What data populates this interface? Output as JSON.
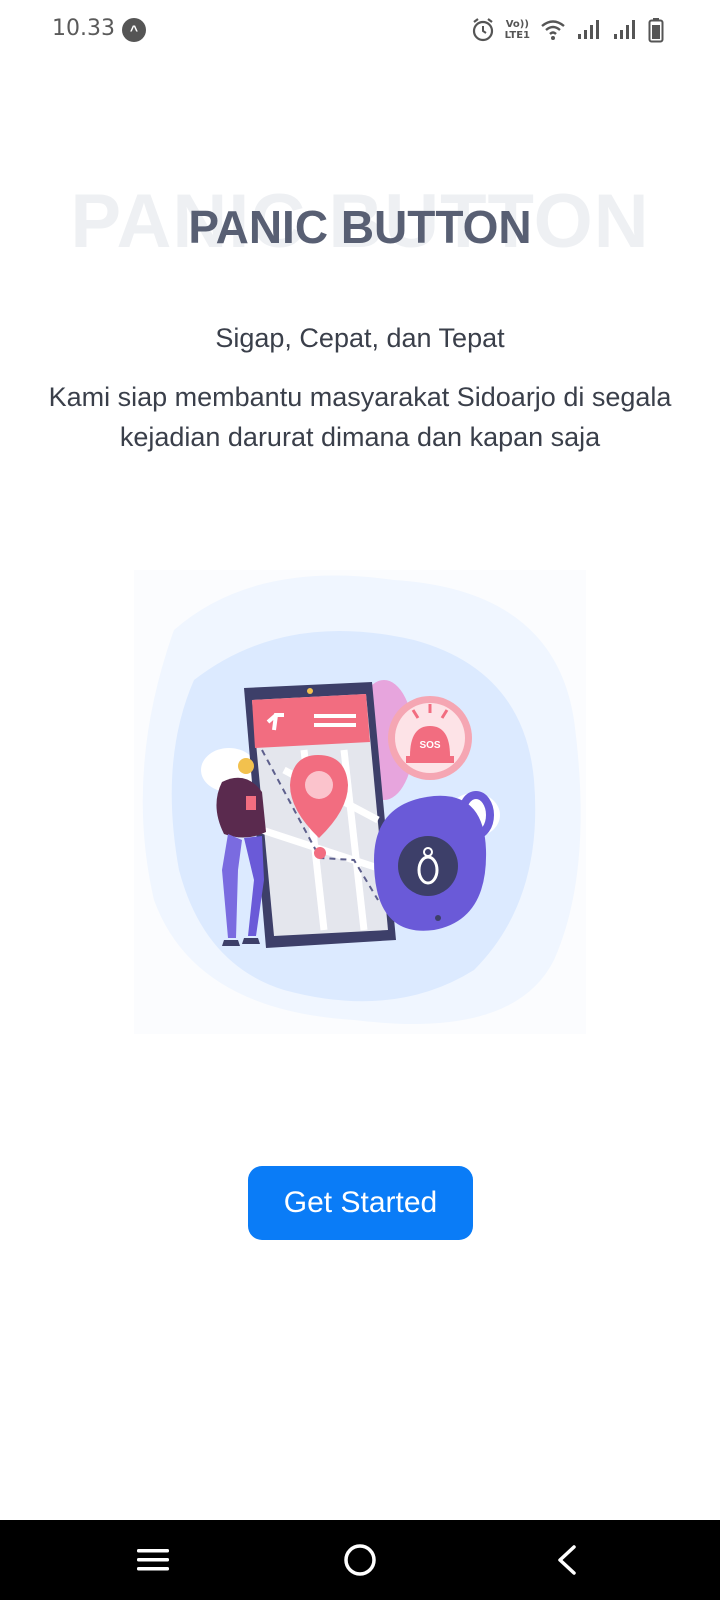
{
  "status_bar": {
    "time": "10.33",
    "icons": [
      "launcher-app-icon",
      "alarm-icon",
      "volte-lte1-icon",
      "wifi-icon",
      "signal-icon",
      "signal-icon",
      "battery-icon"
    ],
    "volte_text": "Vo))",
    "lte_text": "LTE1"
  },
  "hero": {
    "ghost_title": "PANIC BUTTON",
    "title": "PANIC BUTTON",
    "tagline": "Sigap, Cepat, dan Tepat",
    "description": "Kami siap membantu masyarakat Sidoarjo di segala kejadian darurat dimana dan kapan saja"
  },
  "illustration": {
    "badge_text": "SOS"
  },
  "actions": {
    "get_started_label": "Get Started"
  },
  "nav": {
    "items": [
      "menu-icon",
      "home-icon",
      "back-icon"
    ]
  },
  "colors": {
    "primary": "#0a7cf7",
    "title": "#585f73",
    "text": "#3a3f4a",
    "accent_pink": "#f0657a",
    "accent_purple": "#6a5ad8"
  }
}
